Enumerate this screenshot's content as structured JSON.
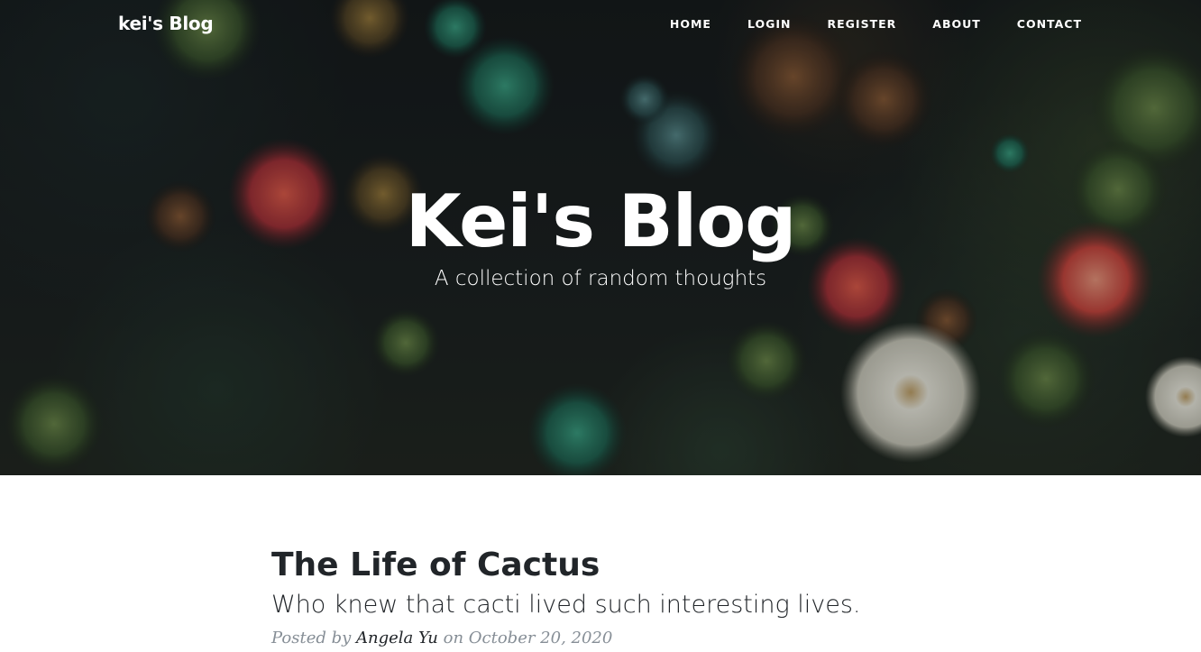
{
  "navbar": {
    "brand": "kei's Blog",
    "links": [
      {
        "label": "HOME"
      },
      {
        "label": "LOGIN"
      },
      {
        "label": "REGISTER"
      },
      {
        "label": "ABOUT"
      },
      {
        "label": "CONTACT"
      }
    ]
  },
  "hero": {
    "title": "Kei's Blog",
    "subtitle": "A collection of random thoughts"
  },
  "posts": [
    {
      "title": "The Life of Cactus",
      "subtitle": "Who knew that cacti lived such interesting lives.",
      "meta_prefix": "Posted by ",
      "author": "Angela Yu",
      "meta_on": " on ",
      "date": "October 20, 2020"
    }
  ]
}
